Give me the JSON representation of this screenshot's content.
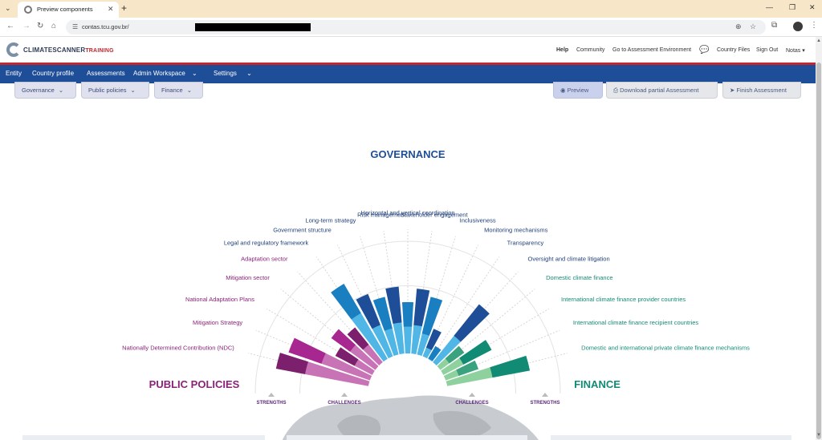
{
  "browser": {
    "tab_title": "Preview components",
    "url_visible": "contas.tcu.gov.br/"
  },
  "app": {
    "logo_main": "CLIMATESCANNER",
    "logo_sub": "TRAINING",
    "top_links": {
      "help": "Help",
      "community": "Community",
      "go_to_assessment": "Go to Assessment Environment",
      "country_files": "Country Files",
      "sign_out": "Sign Out",
      "notas": "Notas"
    },
    "nav": {
      "entity": "Entity",
      "country_profile": "Country profile",
      "assessments": "Assessments",
      "admin_workspace": "Admin Workspace",
      "settings": "Settings"
    },
    "subnav": {
      "governance": "Governance",
      "public_policies": "Public policies",
      "finance": "Finance"
    },
    "actions": {
      "preview": "Preview",
      "download": "Download partial Assessment",
      "finish": "Finish Assessment"
    },
    "colors": {
      "nav_bg": "#1f4e98",
      "accent_red": "#c1272d",
      "governance": "#1f4e98",
      "public_policies": "#8b2379",
      "finance": "#12877a"
    }
  },
  "chart_data": {
    "type": "radial-bar",
    "sections": {
      "governance": "GOVERNANCE",
      "public_policies": "PUBLIC POLICIES",
      "finance": "FINANCE"
    },
    "scale_labels": {
      "strengths": "STRENGTHS",
      "challenges": "CHALLENGES"
    },
    "categories": [
      {
        "label": "Nationally Determined Contribution (NDC)",
        "group": "public_policies",
        "strength": 0.95,
        "challenge": 0.83
      },
      {
        "label": "Mitigation Strategy",
        "group": "public_policies",
        "strength": 0.87,
        "challenge": 0.68
      },
      {
        "label": "National Adaptation Plans",
        "group": "public_policies",
        "strength": 0.42,
        "challenge": 0.32
      },
      {
        "label": "Mitigation sector",
        "group": "public_policies",
        "strength": 0.55,
        "challenge": 0.45
      },
      {
        "label": "Adaptation sector",
        "group": "public_policies",
        "strength": 0.45,
        "challenge": 0.35
      },
      {
        "label": "Legal and regulatory framework",
        "group": "governance",
        "strength": 0.88,
        "challenge": 0.7
      },
      {
        "label": "Government structure",
        "group": "governance",
        "strength": 0.68,
        "challenge": 0.48
      },
      {
        "label": "Long-term strategy",
        "group": "governance",
        "strength": 0.6,
        "challenge": 0.4
      },
      {
        "label": "Risk management",
        "group": "governance",
        "strength": 0.68,
        "challenge": 0.45
      },
      {
        "label": "Horizontal and vertical coordination",
        "group": "governance",
        "strength": 0.52,
        "challenge": 0.4
      },
      {
        "label": "Stakeholder engagement",
        "group": "governance",
        "strength": 0.66,
        "challenge": 0.42
      },
      {
        "label": "Inclusiveness",
        "group": "governance",
        "strength": 0.6,
        "challenge": 0.34
      },
      {
        "label": "Monitoring mechanisms",
        "group": "governance",
        "strength": 0.3,
        "challenge": 0.2
      },
      {
        "label": "Transparency",
        "group": "governance",
        "strength": 0.15,
        "challenge": 0.1
      },
      {
        "label": "Oversight and climate litigation",
        "group": "governance",
        "strength": 0.75,
        "challenge": 0.48
      },
      {
        "label": "Domestic climate finance",
        "group": "finance",
        "strength": 0.3,
        "challenge": 0.22
      },
      {
        "label": "International climate finance provider countries",
        "group": "finance",
        "strength": 0.55,
        "challenge": 0.35
      },
      {
        "label": "International climate finance recipient countries",
        "group": "finance",
        "strength": 0.35,
        "challenge": 0.25
      },
      {
        "label": "Domestic and international private climate finance mechanisms",
        "group": "finance",
        "strength": 0.85,
        "challenge": 0.62
      }
    ]
  }
}
